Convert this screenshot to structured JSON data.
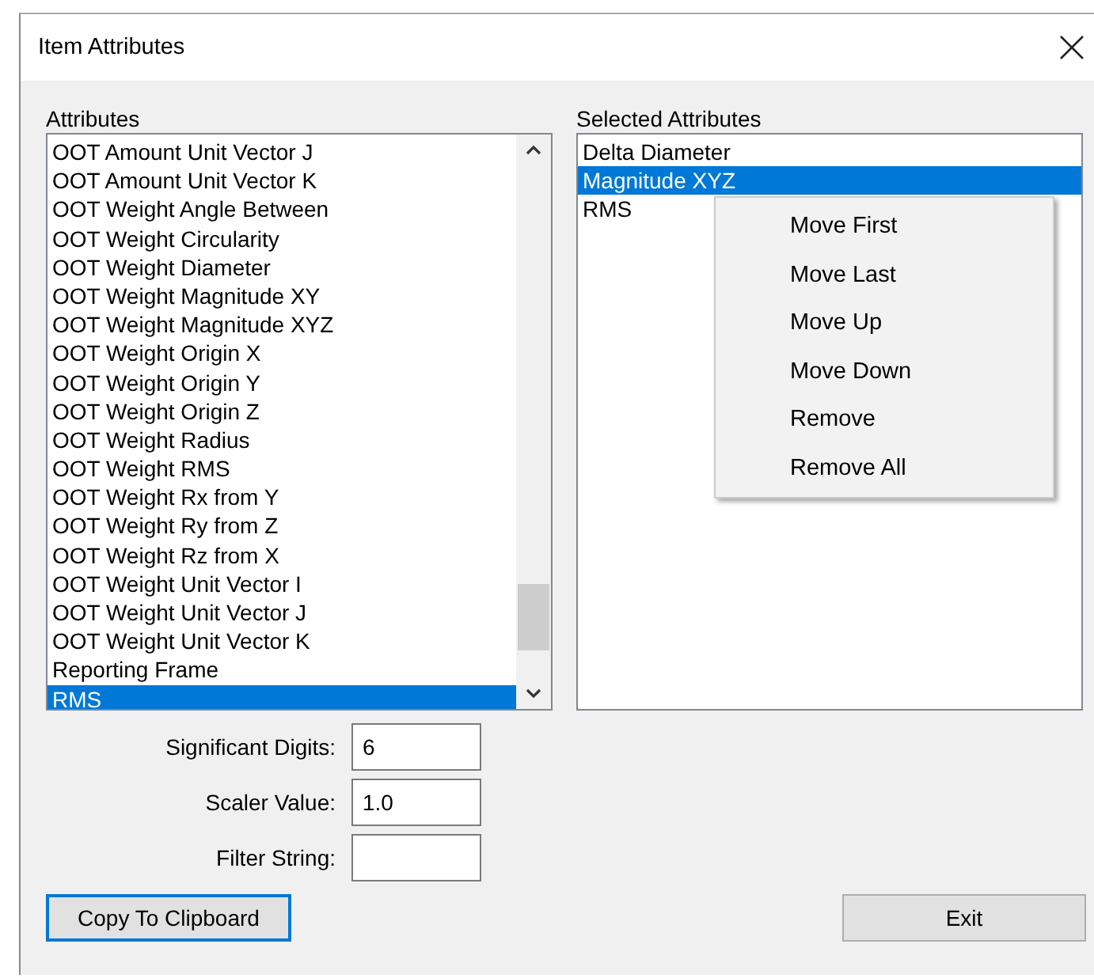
{
  "window": {
    "title": "Item Attributes"
  },
  "attributes": {
    "label": "Attributes",
    "items": [
      {
        "text": "OOT Amount Unit Vector J",
        "selected": false
      },
      {
        "text": "OOT Amount Unit Vector K",
        "selected": false
      },
      {
        "text": "OOT Weight Angle Between",
        "selected": false
      },
      {
        "text": "OOT Weight Circularity",
        "selected": false
      },
      {
        "text": "OOT Weight Diameter",
        "selected": false
      },
      {
        "text": "OOT Weight Magnitude XY",
        "selected": false
      },
      {
        "text": "OOT Weight Magnitude XYZ",
        "selected": false
      },
      {
        "text": "OOT Weight Origin X",
        "selected": false
      },
      {
        "text": "OOT Weight Origin Y",
        "selected": false
      },
      {
        "text": "OOT Weight Origin Z",
        "selected": false
      },
      {
        "text": "OOT Weight Radius",
        "selected": false
      },
      {
        "text": "OOT Weight RMS",
        "selected": false
      },
      {
        "text": "OOT Weight Rx from Y",
        "selected": false
      },
      {
        "text": "OOT Weight Ry from Z",
        "selected": false
      },
      {
        "text": "OOT Weight Rz from X",
        "selected": false
      },
      {
        "text": "OOT Weight Unit Vector I",
        "selected": false
      },
      {
        "text": "OOT Weight Unit Vector J",
        "selected": false
      },
      {
        "text": "OOT Weight Unit Vector K",
        "selected": false
      },
      {
        "text": "Reporting Frame",
        "selected": false
      },
      {
        "text": "RMS",
        "selected": true
      }
    ]
  },
  "selected_attributes": {
    "label": "Selected Attributes",
    "items": [
      {
        "text": "Delta Diameter",
        "selected": false
      },
      {
        "text": "Magnitude XYZ",
        "selected": true
      },
      {
        "text": "RMS",
        "selected": false
      }
    ]
  },
  "context_menu": [
    "Move First",
    "Move Last",
    "Move Up",
    "Move Down",
    "Remove",
    "Remove All"
  ],
  "fields": [
    {
      "label": "Significant Digits:",
      "value": "6"
    },
    {
      "label": "Scaler Value:",
      "value": "1.0"
    },
    {
      "label": "Filter String:"
    }
  ],
  "buttons": [
    {
      "label": "Copy To Clipboard",
      "focused": true
    },
    {
      "label": "Exit",
      "focused": false
    }
  ]
}
